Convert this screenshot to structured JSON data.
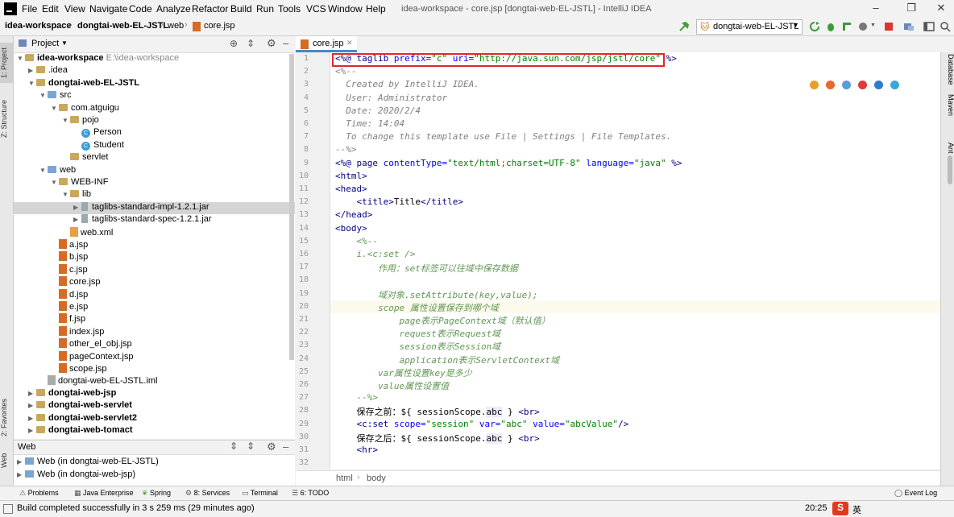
{
  "window": {
    "title": "idea-workspace - core.jsp [dongtai-web-EL-JSTL] - IntelliJ IDEA",
    "menu": [
      "File",
      "Edit",
      "View",
      "Navigate",
      "Code",
      "Analyze",
      "Refactor",
      "Build",
      "Run",
      "Tools",
      "VCS",
      "Window",
      "Help"
    ]
  },
  "breadcrumbs": [
    "idea-workspace",
    "dongtai-web-EL-JSTL",
    "web",
    "core.jsp"
  ],
  "run_config": "dongtai-web-EL-JSTL",
  "left_tabs": [
    "1: Project",
    "Z: Structure",
    "2: Favorites",
    "Web"
  ],
  "right_tabs": [
    "Database",
    "Maven",
    "Ant"
  ],
  "project_panel": {
    "title": "Project",
    "tree": [
      {
        "label": "idea-workspace",
        "extra": "E:\\idea-workspace",
        "depth": 0,
        "kind": "folder",
        "open": true,
        "bold": true
      },
      {
        "label": ".idea",
        "depth": 1,
        "kind": "folder",
        "open": false
      },
      {
        "label": "dongtai-web-EL-JSTL",
        "depth": 1,
        "kind": "folder",
        "open": true,
        "bold": true
      },
      {
        "label": "src",
        "depth": 2,
        "kind": "folder-blue",
        "open": true
      },
      {
        "label": "com.atguigu",
        "depth": 3,
        "kind": "folder",
        "open": true
      },
      {
        "label": "pojo",
        "depth": 4,
        "kind": "folder",
        "open": true
      },
      {
        "label": "Person",
        "depth": 5,
        "kind": "class"
      },
      {
        "label": "Student",
        "depth": 5,
        "kind": "class"
      },
      {
        "label": "servlet",
        "depth": 4,
        "kind": "folder"
      },
      {
        "label": "web",
        "depth": 2,
        "kind": "folder-blue",
        "open": true
      },
      {
        "label": "WEB-INF",
        "depth": 3,
        "kind": "folder",
        "open": true
      },
      {
        "label": "lib",
        "depth": 4,
        "kind": "folder",
        "open": true
      },
      {
        "label": "taglibs-standard-impl-1.2.1.jar",
        "depth": 5,
        "kind": "jar",
        "open": false,
        "selected": true
      },
      {
        "label": "taglibs-standard-spec-1.2.1.jar",
        "depth": 5,
        "kind": "jar",
        "open": false
      },
      {
        "label": "web.xml",
        "depth": 4,
        "kind": "xml"
      },
      {
        "label": "a.jsp",
        "depth": 3,
        "kind": "jsp"
      },
      {
        "label": "b.jsp",
        "depth": 3,
        "kind": "jsp"
      },
      {
        "label": "c.jsp",
        "depth": 3,
        "kind": "jsp"
      },
      {
        "label": "core.jsp",
        "depth": 3,
        "kind": "jsp"
      },
      {
        "label": "d.jsp",
        "depth": 3,
        "kind": "jsp"
      },
      {
        "label": "e.jsp",
        "depth": 3,
        "kind": "jsp"
      },
      {
        "label": "f.jsp",
        "depth": 3,
        "kind": "jsp"
      },
      {
        "label": "index.jsp",
        "depth": 3,
        "kind": "jsp"
      },
      {
        "label": "other_el_obj.jsp",
        "depth": 3,
        "kind": "jsp"
      },
      {
        "label": "pageContext.jsp",
        "depth": 3,
        "kind": "jsp"
      },
      {
        "label": "scope.jsp",
        "depth": 3,
        "kind": "jsp"
      },
      {
        "label": "dongtai-web-EL-JSTL.iml",
        "depth": 2,
        "kind": "iml"
      },
      {
        "label": "dongtai-web-jsp",
        "depth": 1,
        "kind": "folder",
        "open": false,
        "bold": true
      },
      {
        "label": "dongtai-web-servlet",
        "depth": 1,
        "kind": "folder",
        "open": false,
        "bold": true
      },
      {
        "label": "dongtai-web-servlet2",
        "depth": 1,
        "kind": "folder",
        "open": false,
        "bold": true
      },
      {
        "label": "dongtai-web-tomact",
        "depth": 1,
        "kind": "folder",
        "open": false,
        "bold": true
      }
    ]
  },
  "web_panel": {
    "title": "Web",
    "items": [
      "Web (in dongtai-web-EL-JSTL)",
      "Web (in dongtai-web-jsp)"
    ]
  },
  "editor": {
    "tab": "core.jsp",
    "current_line": 20,
    "lines": [
      {
        "n": 1,
        "parts": [
          [
            "<%@ ",
            "kw"
          ],
          [
            "taglib ",
            "kw"
          ],
          [
            "prefix=",
            "at"
          ],
          [
            "\"c\"",
            "st"
          ],
          [
            " uri=",
            "at"
          ],
          [
            "\"http://java.sun.com/jsp/jstl/core\"",
            "st"
          ],
          [
            " %>",
            "kw"
          ]
        ]
      },
      {
        "n": 2,
        "parts": [
          [
            "<%--",
            "cm"
          ]
        ]
      },
      {
        "n": 3,
        "parts": [
          [
            "  Created by IntelliJ IDEA.",
            "cm"
          ]
        ]
      },
      {
        "n": 4,
        "parts": [
          [
            "  User: Administrator",
            "cm"
          ]
        ]
      },
      {
        "n": 5,
        "parts": [
          [
            "  Date: 2020/2/4",
            "cm"
          ]
        ]
      },
      {
        "n": 6,
        "parts": [
          [
            "  Time: 14:04",
            "cm"
          ]
        ]
      },
      {
        "n": 7,
        "parts": [
          [
            "  To change this template use File | Settings | File Templates.",
            "cm"
          ]
        ]
      },
      {
        "n": 8,
        "parts": [
          [
            "--%>",
            "cm"
          ]
        ]
      },
      {
        "n": 9,
        "parts": [
          [
            "<%@ ",
            "kw"
          ],
          [
            "page ",
            "kw"
          ],
          [
            "contentType=",
            "at"
          ],
          [
            "\"text/html;charset=UTF-8\"",
            "st"
          ],
          [
            " language=",
            "at"
          ],
          [
            "\"java\"",
            "st"
          ],
          [
            " %>",
            "kw"
          ]
        ]
      },
      {
        "n": 10,
        "parts": [
          [
            "<html>",
            "tg"
          ]
        ]
      },
      {
        "n": 11,
        "parts": [
          [
            "<head>",
            "tg"
          ]
        ]
      },
      {
        "n": 12,
        "parts": [
          [
            "    ",
            ""
          ],
          [
            "<title>",
            "tg"
          ],
          [
            "Title",
            ""
          ],
          [
            "</title>",
            "tg"
          ]
        ]
      },
      {
        "n": 13,
        "parts": [
          [
            "</head>",
            "tg"
          ]
        ]
      },
      {
        "n": 14,
        "parts": [
          [
            "<body>",
            "tg"
          ]
        ]
      },
      {
        "n": 15,
        "parts": [
          [
            "    <%--",
            "ju"
          ]
        ]
      },
      {
        "n": 16,
        "parts": [
          [
            "    i.<c:set />",
            "ju"
          ]
        ]
      },
      {
        "n": 17,
        "parts": [
          [
            "        作用：set标签可以往域中保存数据",
            "ju"
          ]
        ]
      },
      {
        "n": 18,
        "parts": [
          [
            "",
            "ju"
          ]
        ]
      },
      {
        "n": 19,
        "parts": [
          [
            "        域对象.setAttribute(key,value);",
            "ju"
          ]
        ]
      },
      {
        "n": 20,
        "parts": [
          [
            "        scope 属性设置保存到哪个域",
            "ju"
          ]
        ]
      },
      {
        "n": 21,
        "parts": [
          [
            "            page表示PageContext域（默认值）",
            "ju"
          ]
        ]
      },
      {
        "n": 22,
        "parts": [
          [
            "            request表示Request域",
            "ju"
          ]
        ]
      },
      {
        "n": 23,
        "parts": [
          [
            "            session表示Session域",
            "ju"
          ]
        ]
      },
      {
        "n": 24,
        "parts": [
          [
            "            application表示ServletContext域",
            "ju"
          ]
        ]
      },
      {
        "n": 25,
        "parts": [
          [
            "        var属性设置key是多少",
            "ju"
          ]
        ]
      },
      {
        "n": 26,
        "parts": [
          [
            "        value属性设置值",
            "ju"
          ]
        ]
      },
      {
        "n": 27,
        "parts": [
          [
            "    --%>",
            "ju"
          ]
        ]
      },
      {
        "n": 28,
        "parts": [
          [
            "    保存之前：${ sessionScope.",
            ""
          ],
          [
            "abc",
            "hl"
          ],
          [
            " } ",
            ""
          ],
          [
            "<br>",
            "tg"
          ]
        ]
      },
      {
        "n": 29,
        "parts": [
          [
            "    ",
            ""
          ],
          [
            "<c:set ",
            "tg"
          ],
          [
            "scope=",
            "at"
          ],
          [
            "\"session\"",
            "st"
          ],
          [
            " var=",
            "at"
          ],
          [
            "\"abc\"",
            "st"
          ],
          [
            " value=",
            "at"
          ],
          [
            "\"abcValue\"",
            "st"
          ],
          [
            "/>",
            "tg"
          ]
        ]
      },
      {
        "n": 30,
        "parts": [
          [
            "    保存之后：${ sessionScope.",
            ""
          ],
          [
            "abc",
            "hl"
          ],
          [
            " } ",
            ""
          ],
          [
            "<br>",
            "tg"
          ]
        ]
      },
      {
        "n": 31,
        "parts": [
          [
            "    ",
            ""
          ],
          [
            "<hr>",
            "tg"
          ]
        ]
      },
      {
        "n": 32,
        "parts": [
          [
            "",
            ""
          ]
        ]
      }
    ],
    "breadcrumb": [
      "html",
      "body"
    ]
  },
  "tool_tabs": [
    "Problems",
    "Java Enterprise",
    "Spring",
    "8: Services",
    "Terminal",
    "6: TODO"
  ],
  "event_log": "Event Log",
  "status": {
    "message": "Build completed successfully in 3 s 259 ms (29 minutes ago)",
    "position": "20:25",
    "ime": "英"
  }
}
